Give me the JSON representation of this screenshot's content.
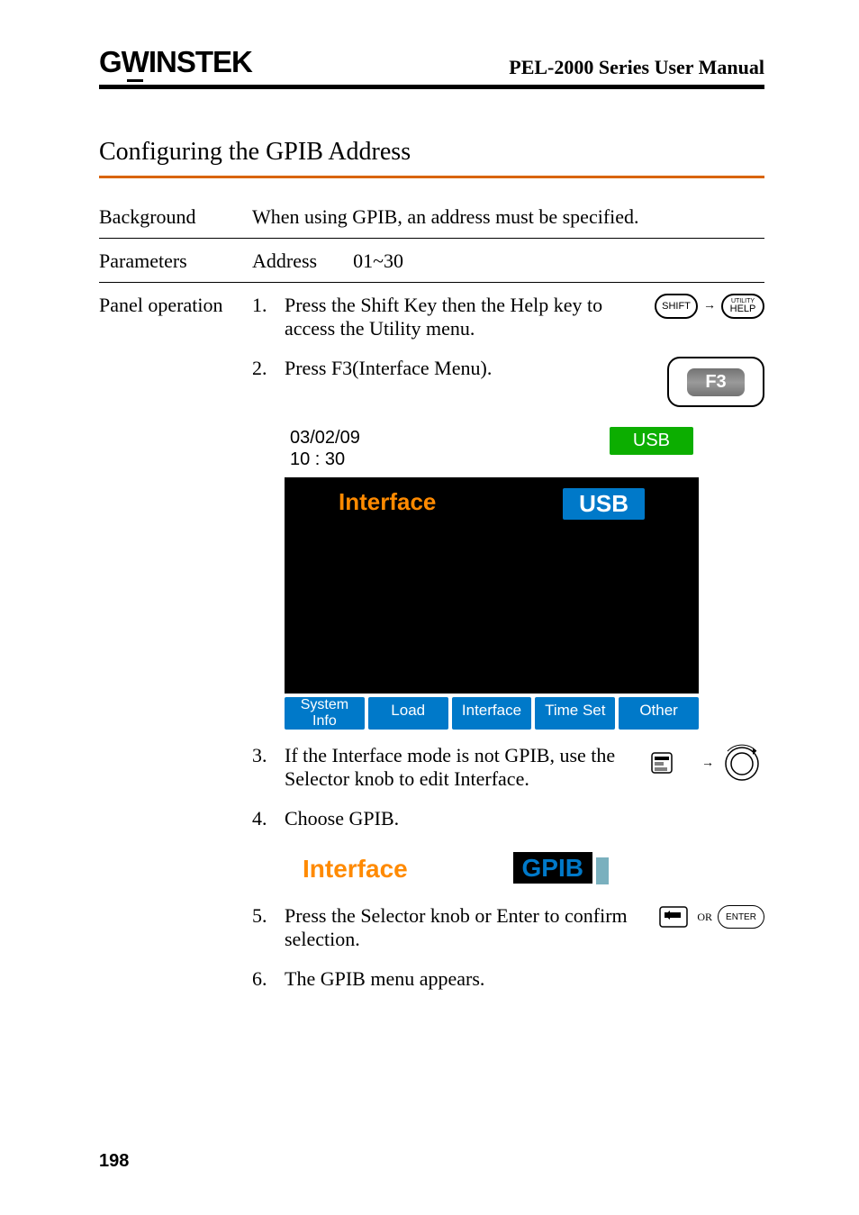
{
  "header": {
    "brand_g": "G",
    "brand_u": "W",
    "brand_rest": "INSTEK",
    "docname": "PEL-2000 Series User Manual"
  },
  "section_title": "Configuring the GPIB Address",
  "rows": {
    "background": {
      "label": "Background",
      "text": "When using GPIB, an address must be specified."
    },
    "parameters": {
      "label": "Parameters",
      "p1": "Address",
      "p2": "01~30"
    },
    "panel": {
      "label": "Panel operation"
    }
  },
  "steps": {
    "s1": {
      "num": "1.",
      "text": "Press the Shift Key then the Help key to access the Utility menu."
    },
    "s2": {
      "num": "2.",
      "text": "Press F3(Interface Menu)."
    },
    "s3": {
      "num": "3.",
      "text": "If the Interface mode is not GPIB, use the Selector knob to edit Interface."
    },
    "s4": {
      "num": "4.",
      "text": "Choose GPIB."
    },
    "s5": {
      "num": "5.",
      "text": "Press the Selector knob or Enter to confirm selection."
    },
    "s6": {
      "num": "6.",
      "text": "The GPIB menu appears."
    }
  },
  "keys": {
    "shift": "SHIFT",
    "help_top": "UTILITY",
    "help": "HELP",
    "f3": "F3",
    "enter": "ENTER",
    "or": "OR"
  },
  "screen1": {
    "date": "03/02/09",
    "time": "10 : 30",
    "usb": "USB",
    "interface": "Interface",
    "iface_val": "USB",
    "btns": {
      "b1a": "System",
      "b1b": "Info",
      "b2": "Load",
      "b3": "Interface",
      "b4": "Time Set",
      "b5": "Other"
    }
  },
  "iface_bar": {
    "label": "Interface",
    "val": "GPIB"
  },
  "page_number": "198"
}
